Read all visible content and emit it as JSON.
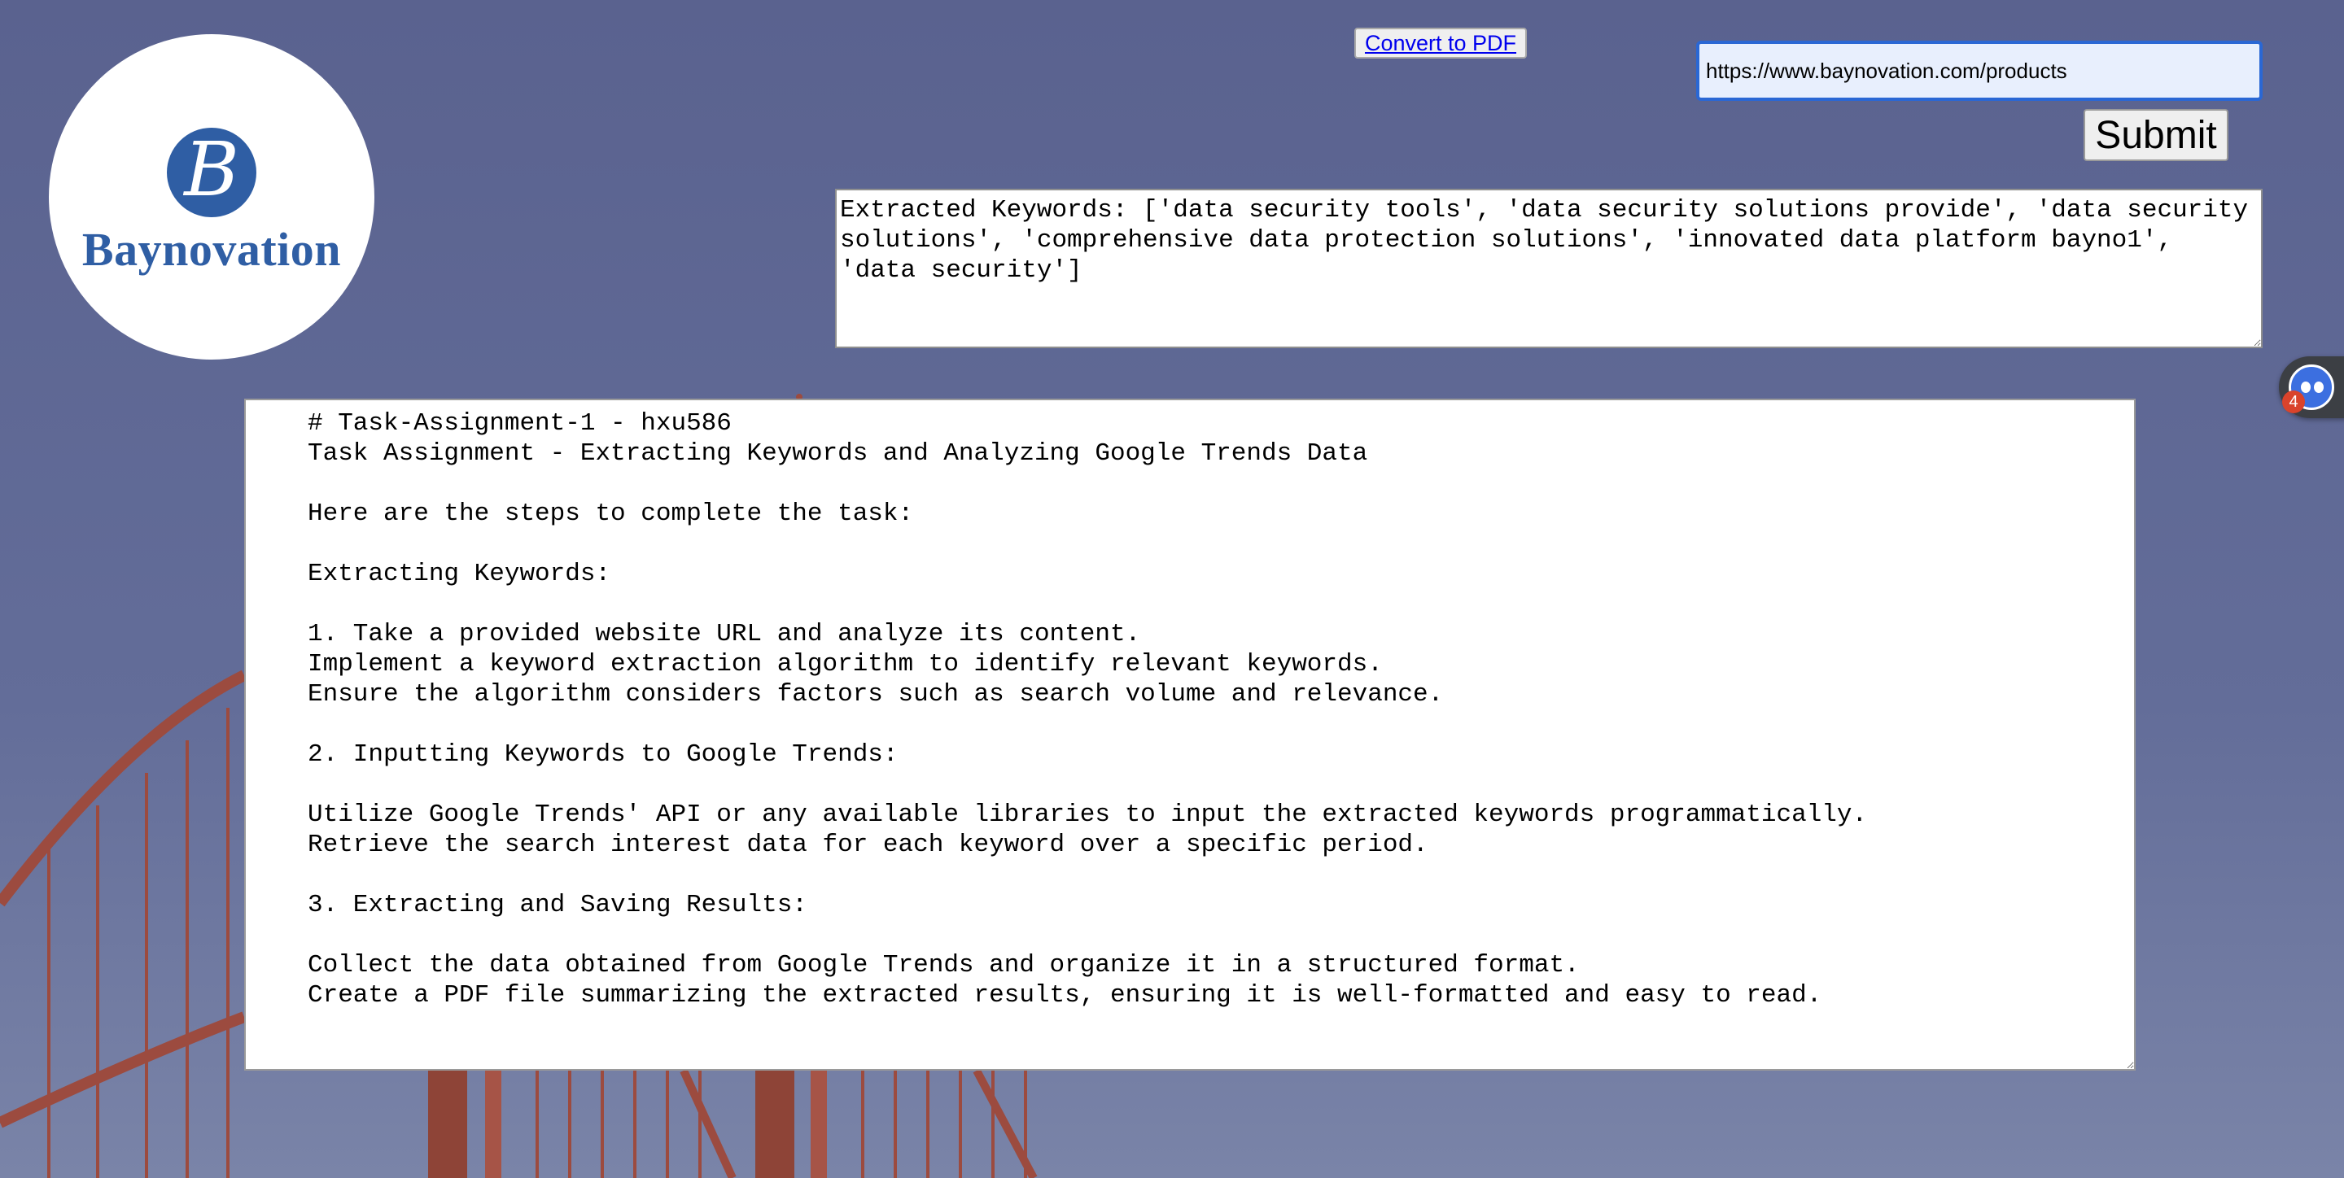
{
  "logo": {
    "monogram": "B",
    "brand_name": "Baynovation"
  },
  "toolbar": {
    "convert_label": "Convert to PDF",
    "submit_label": "Submit"
  },
  "url_input": {
    "value": "https://www.baynovation.com/products"
  },
  "keywords_output": {
    "text": "Extracted Keywords: ['data security tools', 'data security solutions provide', 'data security solutions', 'comprehensive data protection solutions', 'innovated data platform bayno1', 'data security']"
  },
  "task_text": {
    "content": "# Task-Assignment-1 - hxu586\nTask Assignment - Extracting Keywords and Analyzing Google Trends Data\n\nHere are the steps to complete the task:\n\nExtracting Keywords:\n\n1. Take a provided website URL and analyze its content.\nImplement a keyword extraction algorithm to identify relevant keywords.\nEnsure the algorithm considers factors such as search volume and relevance.\n\n2. Inputting Keywords to Google Trends:\n\nUtilize Google Trends' API or any available libraries to input the extracted keywords programmatically.\nRetrieve the search interest data for each keyword over a specific period.\n\n3. Extracting and Saving Results:\n\nCollect the data obtained from Google Trends and organize it in a structured format.\nCreate a PDF file summarizing the extracted results, ensuring it is well-formatted and easy to read."
  },
  "widget": {
    "badge_count": "4"
  },
  "colors": {
    "background": "#5f6894",
    "brand_blue": "#2f5ea4",
    "link_blue": "#0000ee",
    "input_focus_border": "#2a67d4",
    "bridge_red": "#9c4b3f"
  }
}
